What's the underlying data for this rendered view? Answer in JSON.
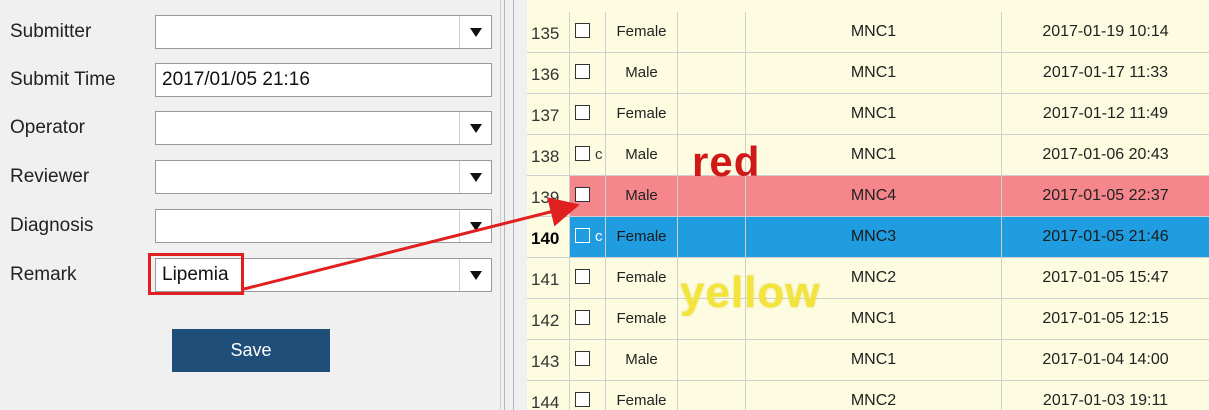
{
  "form": {
    "fields": [
      {
        "label": "Submitter",
        "value": "",
        "type": "dropdown"
      },
      {
        "label": "Submit Time",
        "value": "2017/01/05 21:16",
        "type": "text"
      },
      {
        "label": "Operator",
        "value": "",
        "type": "dropdown"
      },
      {
        "label": "Reviewer",
        "value": "",
        "type": "dropdown"
      },
      {
        "label": "Diagnosis",
        "value": "",
        "type": "dropdown"
      },
      {
        "label": "Remark",
        "value": "Lipemia",
        "type": "dropdown"
      }
    ],
    "save_label": "Save"
  },
  "grid": {
    "rows": [
      {
        "num": "135",
        "extra": "",
        "gender": "Female",
        "type": "MNC1",
        "date": "2017-01-19 10:14",
        "state": "normal"
      },
      {
        "num": "136",
        "extra": "",
        "gender": "Male",
        "type": "MNC1",
        "date": "2017-01-17 11:33",
        "state": "normal"
      },
      {
        "num": "137",
        "extra": "",
        "gender": "Female",
        "type": "MNC1",
        "date": "2017-01-12 11:49",
        "state": "normal"
      },
      {
        "num": "138",
        "extra": "c",
        "gender": "Male",
        "type": "MNC1",
        "date": "2017-01-06 20:43",
        "state": "normal"
      },
      {
        "num": "139",
        "extra": "",
        "gender": "Male",
        "type": "MNC4",
        "date": "2017-01-05 22:37",
        "state": "red"
      },
      {
        "num": "140",
        "extra": "c",
        "gender": "Female",
        "type": "MNC3",
        "date": "2017-01-05 21:46",
        "state": "selected"
      },
      {
        "num": "141",
        "extra": "",
        "gender": "Female",
        "type": "MNC2",
        "date": "2017-01-05 15:47",
        "state": "normal"
      },
      {
        "num": "142",
        "extra": "",
        "gender": "Female",
        "type": "MNC1",
        "date": "2017-01-05 12:15",
        "state": "normal"
      },
      {
        "num": "143",
        "extra": "",
        "gender": "Male",
        "type": "MNC1",
        "date": "2017-01-04 14:00",
        "state": "normal"
      },
      {
        "num": "144",
        "extra": "",
        "gender": "Female",
        "type": "MNC2",
        "date": "2017-01-03 19:11",
        "state": "normal"
      }
    ]
  },
  "annotations": {
    "red_label": "red",
    "yellow_label": "yellow"
  },
  "colors": {
    "row_bg": "#fdfbe0",
    "row_red": "#f4868c",
    "row_selected": "#1f9de0",
    "save_button": "#1f4e79",
    "annotation_red": "#d01818",
    "annotation_yellow": "#f2e43a"
  },
  "icons": [
    "dropdown-arrow-icon",
    "checkbox-icon",
    "arrow-annotation-icon"
  ]
}
